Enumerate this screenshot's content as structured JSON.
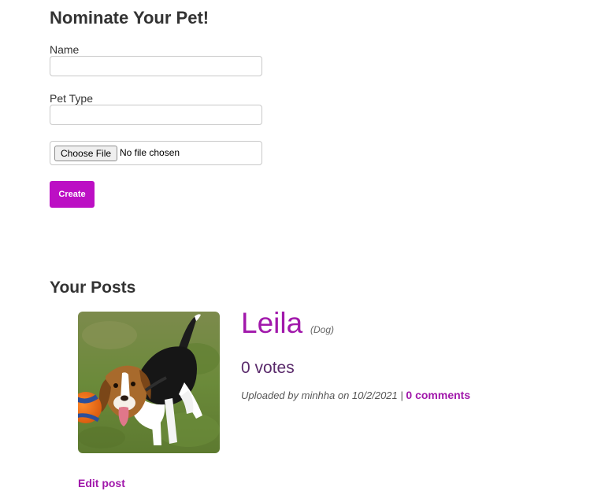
{
  "form": {
    "title": "Nominate Your Pet!",
    "name_label": "Name",
    "name_value": "",
    "pet_type_label": "Pet Type",
    "pet_type_value": "",
    "file_button_label": "Choose File",
    "file_status": "No file chosen",
    "create_label": "Create"
  },
  "posts": {
    "title": "Your Posts",
    "items": [
      {
        "pet_name": "Leila",
        "pet_type": "(Dog)",
        "votes": "0 votes",
        "uploaded_text": "Uploaded by minhha on 10/2/2021",
        "separator": "|",
        "comments_label": "0 comments",
        "edit_label": "Edit post",
        "image_subject": "beagle-dog-photo"
      }
    ]
  },
  "colors": {
    "accent": "#bc0fc4",
    "link": "#a118ab",
    "heading": "#333333"
  }
}
